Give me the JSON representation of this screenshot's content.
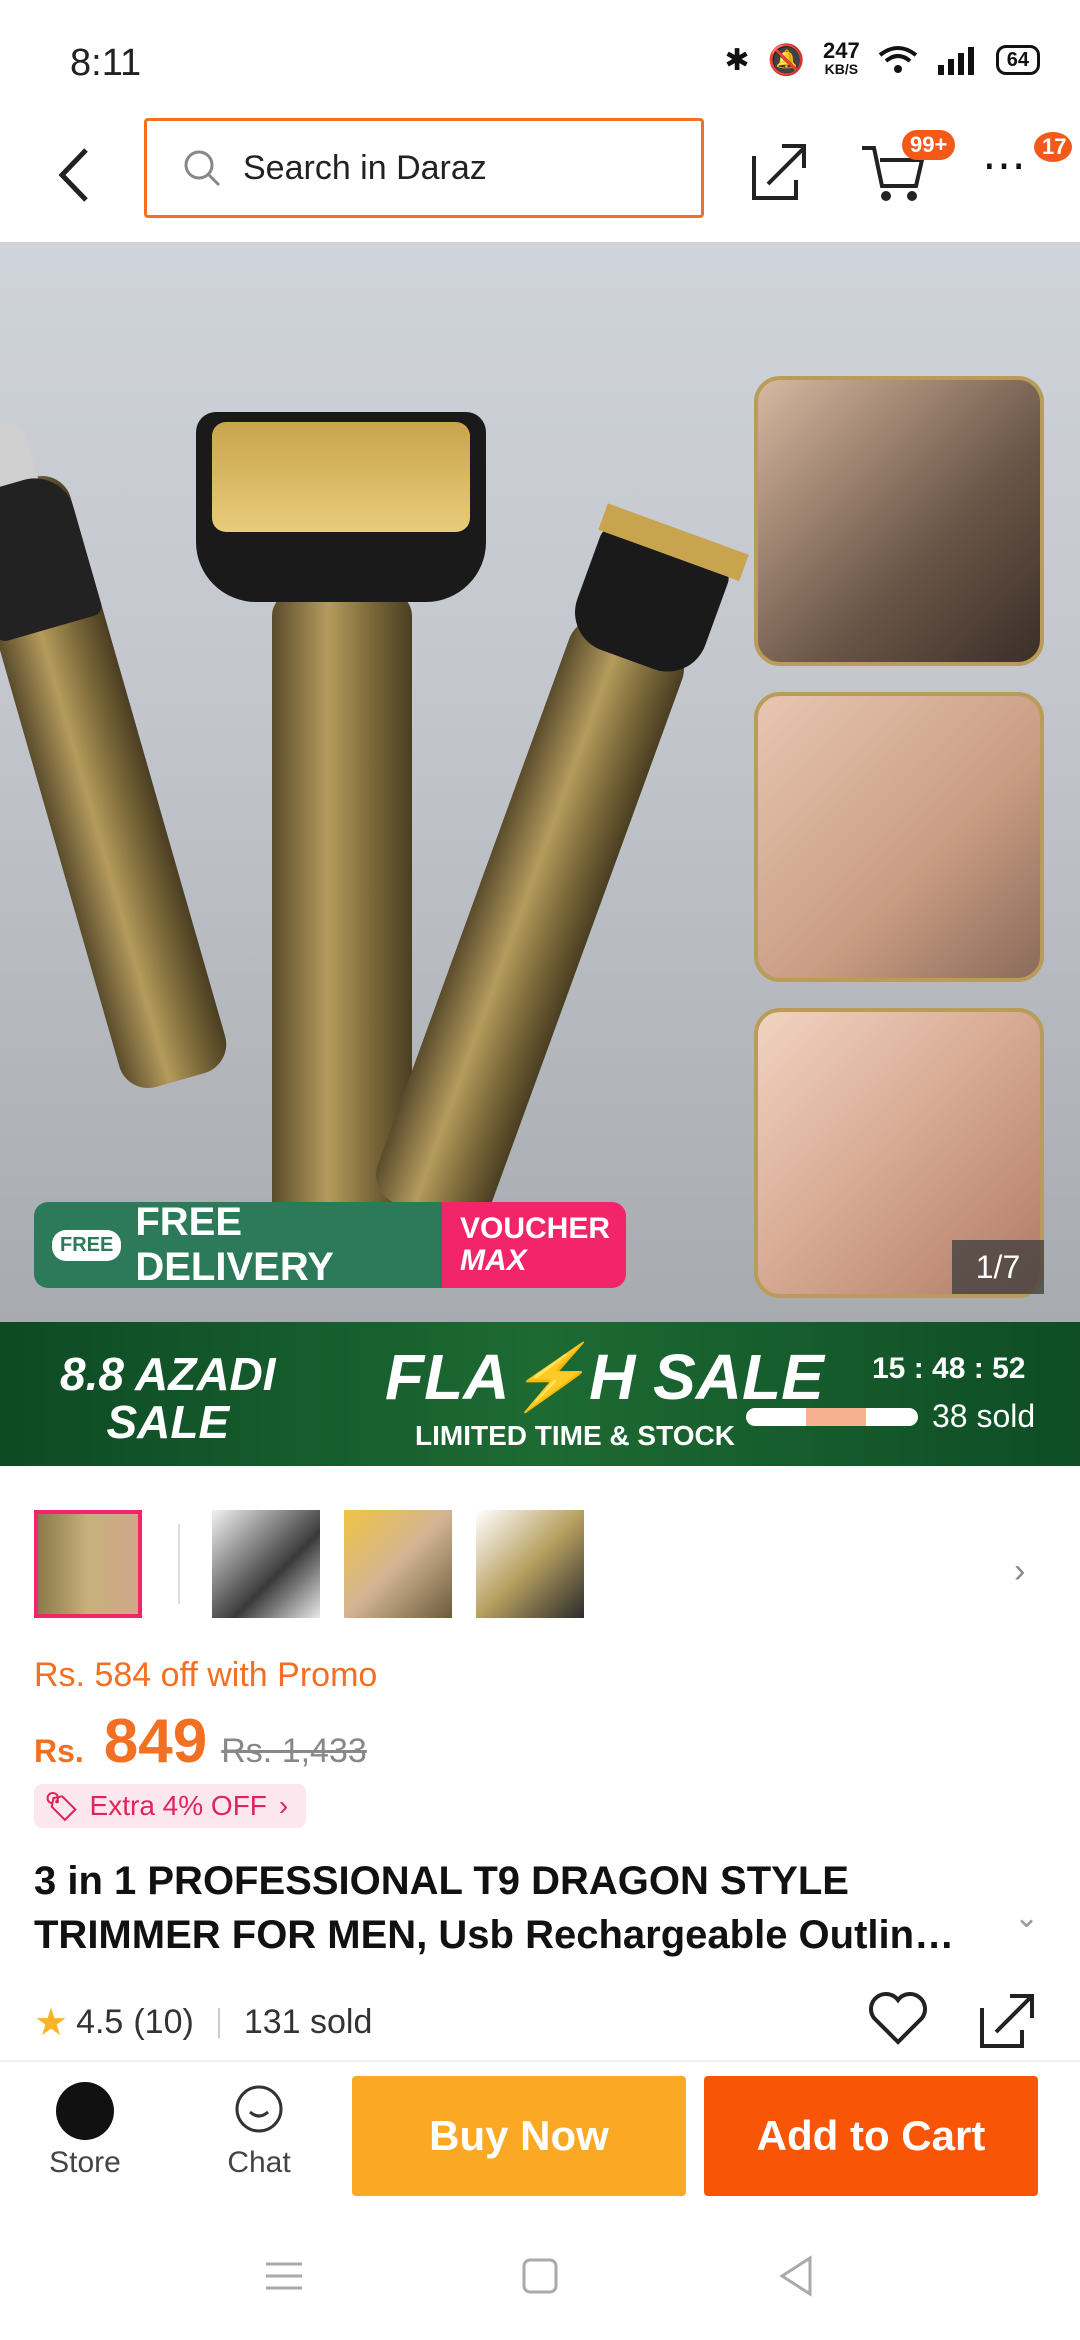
{
  "status_bar": {
    "time": "8:11",
    "speed_value": "247",
    "speed_unit": "KB/S",
    "battery": "64"
  },
  "header": {
    "search_placeholder": "Search in Daraz",
    "cart_badge": "99+",
    "more_badge": "17"
  },
  "hero": {
    "image_counter": "1/7",
    "delivery_label": "FREE DELIVERY",
    "delivery_tag": "FREE",
    "voucher_line1": "VOUCHER",
    "voucher_line2": "MAX"
  },
  "flash_sale": {
    "event_line1": "8.8 AZADI",
    "event_line2": "SALE",
    "title": "FLA⚡H SALE",
    "subtitle": "LIMITED TIME & STOCK",
    "timer_h": "15",
    "timer_m": "48",
    "timer_s": "52",
    "sold": "38 sold",
    "progress": 0.35
  },
  "gallery": {
    "thumbnail_count": 4
  },
  "pricing": {
    "promo_text": "Rs. 584 off with Promo",
    "currency": "Rs.",
    "price": "849",
    "original_price": "Rs. 1,433",
    "extra_offer": "Extra 4% OFF"
  },
  "product": {
    "title_line1": "3 in 1 PROFESSIONAL T9 DRAGON STYLE",
    "title_line2": "TRIMMER FOR MEN, Usb Rechargeable Outlin…",
    "rating": "4.5",
    "review_count": "(10)",
    "sold": "131 sold"
  },
  "bottom_bar": {
    "store_label": "Store",
    "chat_label": "Chat",
    "buy_now": "Buy Now",
    "add_to_cart": "Add to Cart"
  },
  "colors": {
    "brand_orange": "#f85606",
    "buy_yellow": "#fba925",
    "promo_pink": "#f2246a",
    "flash_green": "#1d6a33"
  }
}
